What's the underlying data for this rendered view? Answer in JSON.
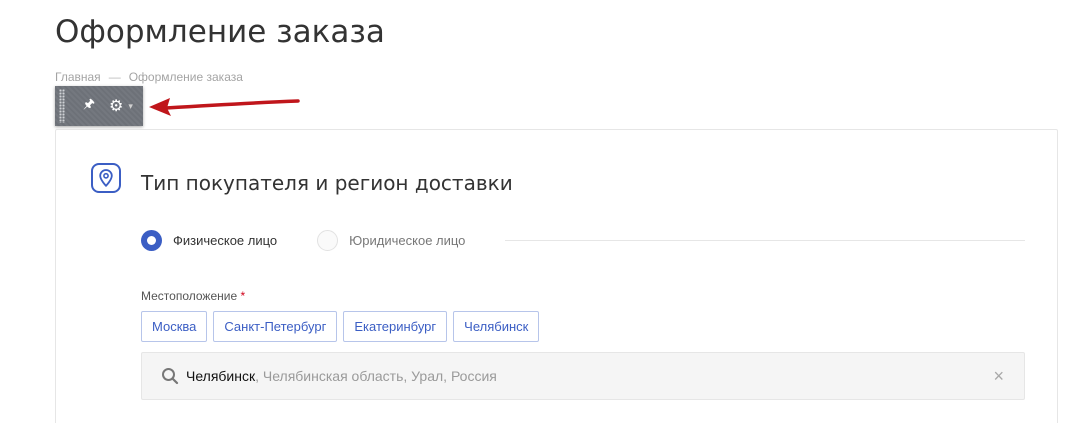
{
  "page": {
    "title": "Оформление заказа",
    "breadcrumb": [
      {
        "label": "Главная"
      },
      {
        "separator": "—"
      },
      {
        "label": "Оформление заказа"
      }
    ]
  },
  "admin_toolbar": {
    "icons": [
      "drag-grip-icon",
      "pin-icon",
      "gear-icon",
      "caret-down-icon"
    ],
    "pin_glyph": "🖈",
    "gear_glyph": "⚙",
    "caret_glyph": "▾"
  },
  "annotation": {
    "arrow_color": "#c0161b"
  },
  "section": {
    "icon": "map-pin-icon",
    "title": "Тип покупателя и регион доставки",
    "accent_color": "#3b5ec4"
  },
  "buyer_type": {
    "options": [
      {
        "label": "Физическое лицо",
        "selected": true
      },
      {
        "label": "Юридическое лицо",
        "selected": false
      }
    ]
  },
  "location": {
    "label": "Местоположение",
    "required_mark": "*",
    "quick_cities": [
      "Москва",
      "Санкт-Петербург",
      "Екатеринбург",
      "Челябинск"
    ],
    "search": {
      "icon": "search-icon",
      "value_main": "Челябинск",
      "value_rest": ", Челябинская область, Урал, Россия",
      "clear_glyph": "×"
    }
  }
}
